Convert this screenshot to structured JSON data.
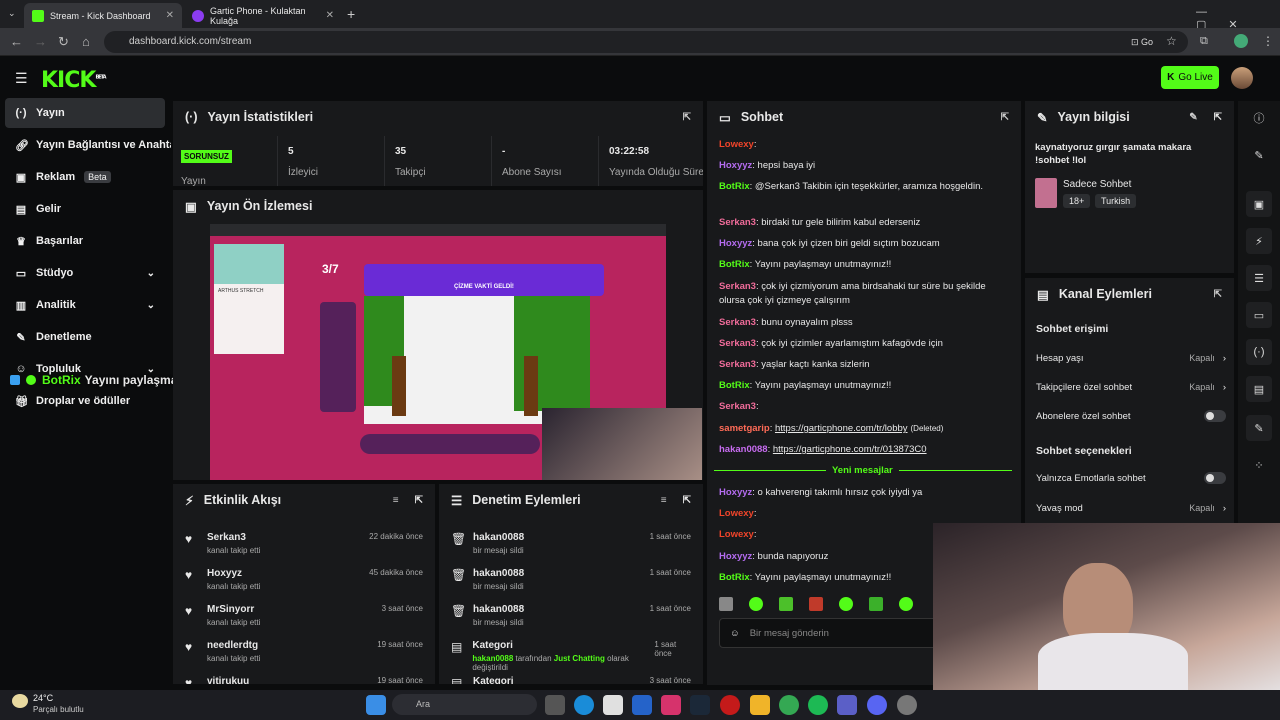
{
  "browser": {
    "tabs": [
      {
        "title": "Stream - Kick Dashboard"
      },
      {
        "title": "Gartic Phone - Kulaktan Kulağa"
      }
    ],
    "url": "dashboard.kick.com/stream"
  },
  "header": {
    "logo": "KICK",
    "logo_sup": "BETA",
    "golive": "Go Live"
  },
  "sidebar": {
    "items": [
      {
        "label": "Yayın"
      },
      {
        "label": "Yayın Bağlantısı ve Anahtar"
      },
      {
        "label": "Reklam",
        "badge": "Beta"
      },
      {
        "label": "Gelir"
      },
      {
        "label": "Başarılar"
      },
      {
        "label": "Stüdyo"
      },
      {
        "label": "Analitik"
      },
      {
        "label": "Denetleme"
      },
      {
        "label": "Topluluk"
      },
      {
        "label": "Droplar ve ödüller"
      }
    ]
  },
  "overlay_alert": {
    "user": "BotRix",
    "text": "Yayını paylaşmayı unutmayınız!!"
  },
  "stats": {
    "title": "Yayın İstatistikleri",
    "items": [
      {
        "value": "SORUNSUZ",
        "label": "Yayın"
      },
      {
        "value": "5",
        "label": "İzleyici"
      },
      {
        "value": "35",
        "label": "Takipçi"
      },
      {
        "value": "-",
        "label": "Abone Sayısı"
      },
      {
        "value": "03:22:58",
        "label": "Yayında Olduğu Süre"
      }
    ]
  },
  "preview": {
    "title": "Yayın Ön İzlemesi",
    "round": "3/7",
    "banner": "ÇİZME VAKTİ GELDİ!",
    "side_title": "ARTHUS STRETCH"
  },
  "activity": {
    "title": "Etkinlik Akışı",
    "rows": [
      {
        "name": "Serkan3",
        "sub": "kanalı takip etti",
        "time": "22 dakika önce"
      },
      {
        "name": "Hoxyyz",
        "sub": "kanalı takip etti",
        "time": "45 dakika önce"
      },
      {
        "name": "MrSinyorr",
        "sub": "kanalı takip etti",
        "time": "3 saat önce"
      },
      {
        "name": "needlerdtg",
        "sub": "kanalı takip etti",
        "time": "19 saat önce"
      },
      {
        "name": "vitirukuu",
        "sub": "",
        "time": "19 saat önce"
      }
    ]
  },
  "moderation": {
    "title": "Denetim Eylemleri",
    "rows": [
      {
        "name": "hakan0088",
        "sub": "bir mesajı sildi",
        "time": "1 saat önce"
      },
      {
        "name": "hakan0088",
        "sub": "bir mesajı sildi",
        "time": "1 saat önce"
      },
      {
        "name": "hakan0088",
        "sub": "bir mesajı sildi",
        "time": "1 saat önce"
      },
      {
        "name": "Kategori",
        "sub_user": "hakan0088",
        "sub_mid": " tarafından ",
        "sub_cat": "Just Chatting",
        "sub_end": " olarak değiştirildi",
        "time": "1 saat önce"
      },
      {
        "name": "Kategori",
        "sub": "",
        "time": "3 saat önce"
      }
    ]
  },
  "chat": {
    "title": "Sohbet",
    "messages": [
      {
        "user": "Lowexy",
        "text": "",
        "color": "#f0442a"
      },
      {
        "user": "Hoxyyz",
        "text": "hepsi baya iyi",
        "color": "#b46cf0"
      },
      {
        "user": "BotRix",
        "text": "@Serkan3 Takibin için teşekkürler, aramıza hoşgeldin.",
        "color": "#53fc18"
      },
      {
        "user": "Serkan3",
        "text": "birdaki tur gele bilirim kabul ederseniz",
        "color": "#f06c9a"
      },
      {
        "user": "Hoxyyz",
        "text": "bana çok iyi çizen biri geldi sıçtım bozucam",
        "color": "#b46cf0"
      },
      {
        "user": "BotRix",
        "text": "Yayını paylaşmayı unutmayınız!!",
        "color": "#53fc18"
      },
      {
        "user": "Serkan3",
        "text": "çok iyi çizmiyorum ama birdsahaki tur süre bu şekilde olursa çok iyi çizmeye çalışırım",
        "color": "#f06c9a"
      },
      {
        "user": "Serkan3",
        "text": "bunu oynayalım plsss",
        "color": "#f06c9a"
      },
      {
        "user": "Serkan3",
        "text": "çok iyi çizimler ayarlamıştım kafagövde için",
        "color": "#f06c9a"
      },
      {
        "user": "Serkan3",
        "text": "yaşlar kaçtı kanka sizlerin",
        "color": "#f06c9a"
      },
      {
        "user": "BotRix",
        "text": "Yayını paylaşmayı unutmayınız!!",
        "color": "#53fc18"
      },
      {
        "user": "Serkan3",
        "text": "",
        "color": "#f06c9a"
      },
      {
        "user": "sametgarip",
        "text": "https://garticphone.com/tr/lobby",
        "deleted": "(Deleted)",
        "color": "#ff6b57"
      },
      {
        "user": "hakan0088",
        "text": "https://garticphone.com/tr/013873C0",
        "color": "#c76cf0"
      },
      {
        "user": "Hoxyyz",
        "text": "o kahverengi takımlı hırsız çok iyiydi ya",
        "color": "#b46cf0"
      },
      {
        "user": "Lowexy",
        "text": "",
        "color": "#f0442a"
      },
      {
        "user": "Lowexy",
        "text": "",
        "color": "#f0442a"
      },
      {
        "user": "Hoxyyz",
        "text": "bunda napıyoruz",
        "color": "#b46cf0"
      },
      {
        "user": "BotRix",
        "text": "Yayını paylaşmayı unutmayınız!!",
        "color": "#53fc18"
      }
    ],
    "divider": "Yeni mesajlar",
    "input_placeholder": "Bir mesaj gönderin"
  },
  "info": {
    "title": "Yayın bilgisi",
    "stream_title": "kaynatıyoruz gırgır şamata makara !sohbet !lol",
    "category": "Sadece Sohbet",
    "tags": [
      "18+",
      "Turkish"
    ]
  },
  "channel": {
    "title": "Kanal Eylemleri",
    "access": "Sohbet erişimi",
    "opts": [
      {
        "label": "Hesap yaşı",
        "value": "Kapalı"
      },
      {
        "label": "Takipçilere özel sohbet",
        "value": "Kapalı"
      },
      {
        "label": "Abonelere özel sohbet",
        "value": ""
      }
    ],
    "chat_opts": "Sohbet seçenekleri",
    "opts2": [
      {
        "label": "Yalnızca Emotlarla sohbet",
        "value": ""
      },
      {
        "label": "Yavaş mod",
        "value": "Kapalı"
      }
    ]
  },
  "taskbar": {
    "temp": "24°C",
    "weather": "Parçalı bulutlu",
    "search": "Ara"
  },
  "colors": {
    "accent": "#53fc18",
    "panel": "#18191b",
    "bg": "#0b0c0d"
  }
}
